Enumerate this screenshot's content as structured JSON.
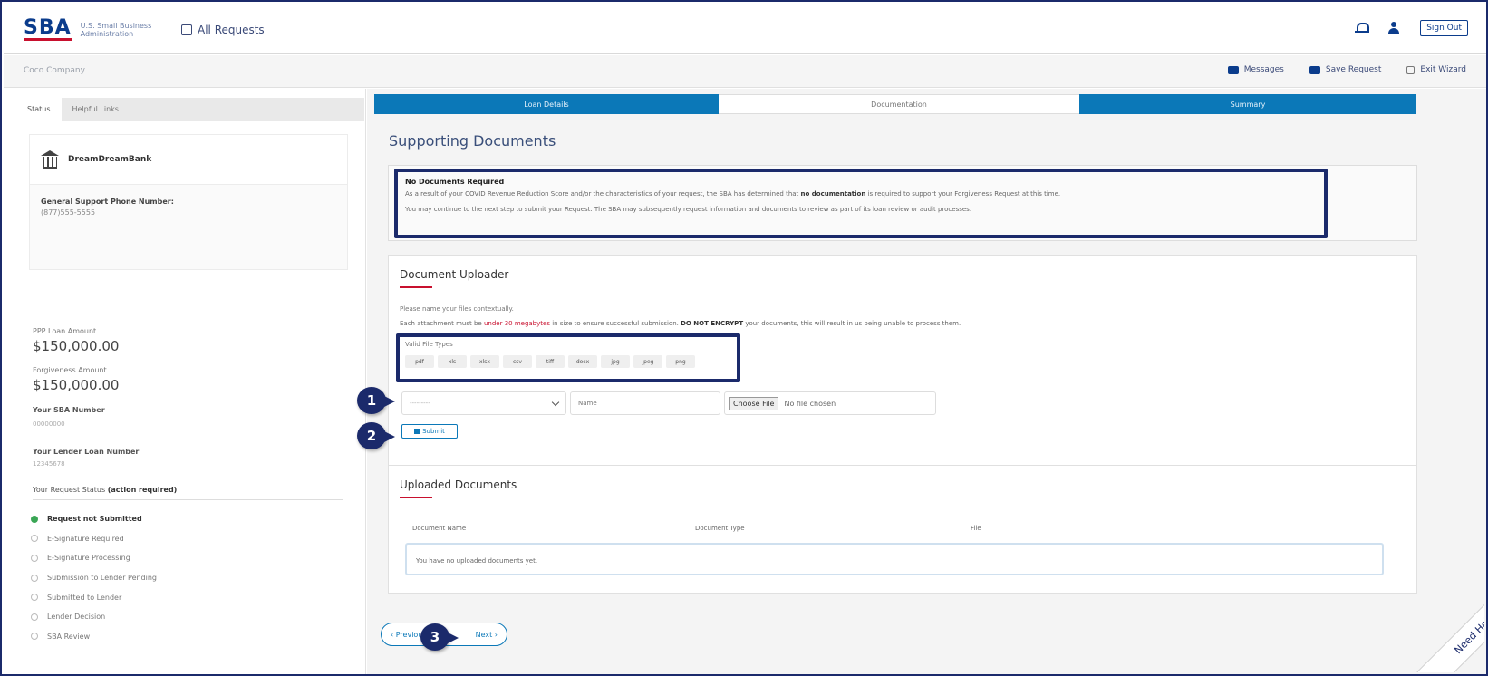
{
  "header": {
    "logo_text": "SBA",
    "logo_sub": "U.S. Small Business Administration",
    "all_requests": "All Requests",
    "sign_out": "Sign Out"
  },
  "subheader": {
    "company": "Coco Company",
    "actions": [
      "Messages",
      "Save Request",
      "Exit Wizard"
    ]
  },
  "sidebar": {
    "tabs": [
      "Status",
      "Helpful Links"
    ],
    "lender_name": "DreamDreamBank",
    "phone_label": "General Support Phone Number:",
    "phone_number": "(877)555-5555",
    "loan_amount_label": "PPP Loan Amount",
    "loan_amount": "$150,000.00",
    "forgiveness_label": "Forgiveness Amount",
    "forgiveness_amount": "$150,000.00",
    "sba_number_label": "Your SBA Number",
    "sba_number": "00000000",
    "lender_loan_label": "Your Lender Loan Number",
    "lender_loan_number": "12345678",
    "status_title_prefix": "Your Request Status",
    "status_title_bold": "(action required)",
    "status_items": [
      "Request not Submitted",
      "E-Signature Required",
      "E-Signature Processing",
      "Submission to Lender Pending",
      "Submitted to Lender",
      "Lender Decision",
      "SBA Review"
    ]
  },
  "steps": [
    "Loan Details",
    "Documentation",
    "Summary"
  ],
  "main": {
    "page_title": "Supporting Documents",
    "notice_title": "No Documents Required",
    "notice_line1_pre": "As a result of your COVID Revenue Reduction Score and/or the characteristics of your request, the SBA has determined that ",
    "notice_line1_bold": "no documentation",
    "notice_line1_post": " is required to support your Forgiveness Request at this time.",
    "notice_line2": "You may continue to the next step to submit your Request. The SBA may subsequently request information and documents to review as part of its loan review or audit processes."
  },
  "uploader": {
    "title": "Document Uploader",
    "text1": "Please name your files contextually.",
    "text2_pre": "Each attachment must be ",
    "text2_red": "under 30 megabytes",
    "text2_mid": " in size to ensure successful submission. ",
    "text2_bold": "DO NOT ENCRYPT",
    "text2_post": " your documents, this will result in us being unable to process them.",
    "filetypes_label": "Valid File Types",
    "filetypes": [
      "pdf",
      "xls",
      "xlsx",
      "csv",
      "tiff",
      "docx",
      "jpg",
      "jpeg",
      "png"
    ],
    "select_placeholder": "---------",
    "name_placeholder": "Name",
    "choose_file": "Choose File",
    "no_file": "No file chosen",
    "submit": "Submit"
  },
  "uploaded": {
    "title": "Uploaded Documents",
    "columns": [
      "Document Name",
      "Document Type",
      "File"
    ],
    "empty": "You have no uploaded documents yet."
  },
  "nav": {
    "previous": "Previous",
    "next": "Next"
  },
  "callouts": [
    "1",
    "2",
    "3"
  ],
  "need_help": "Need Help"
}
